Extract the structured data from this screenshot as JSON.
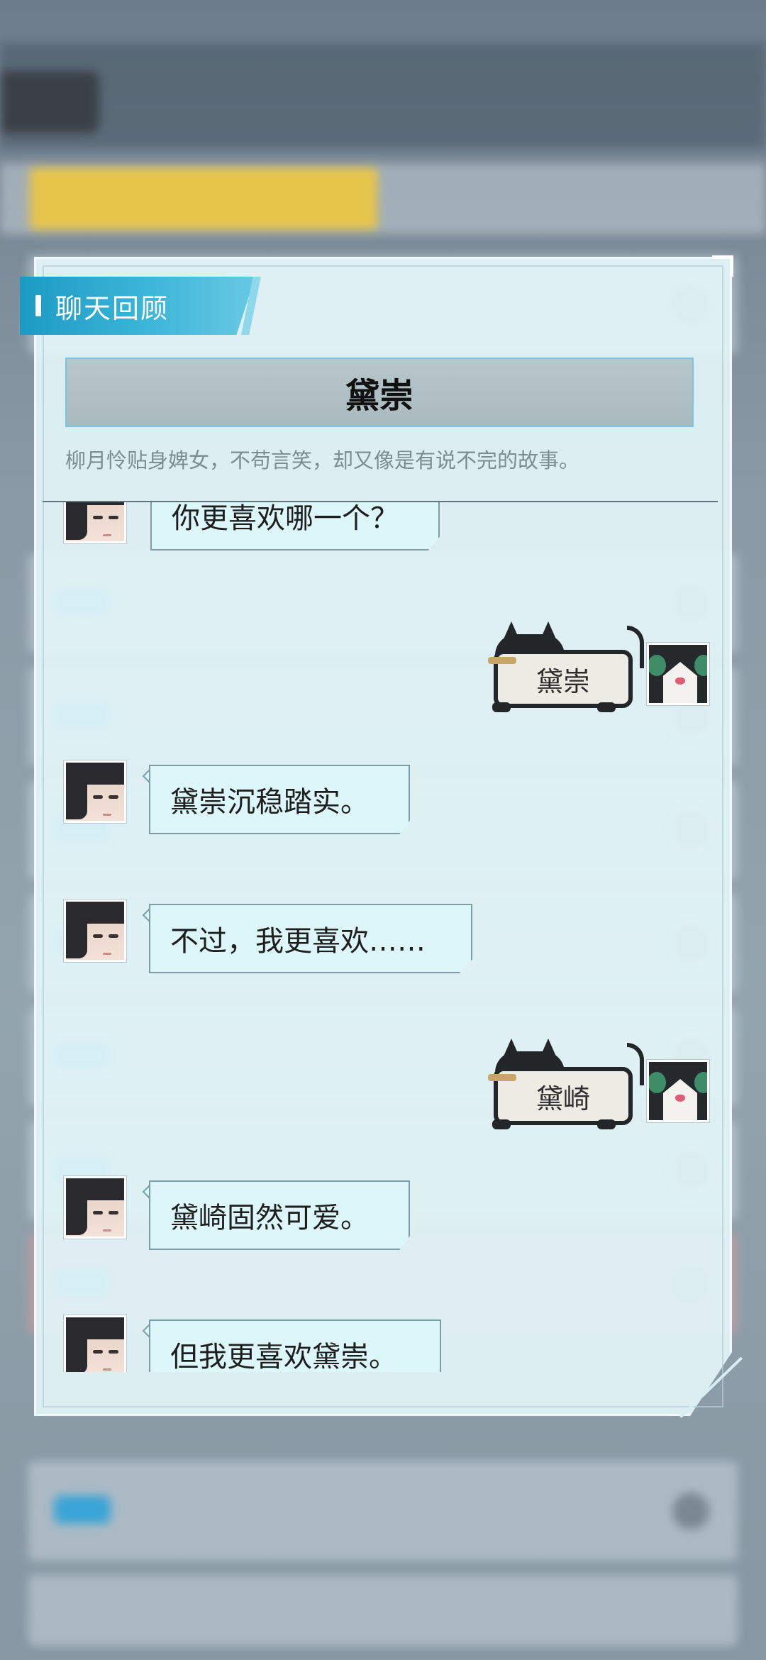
{
  "panel": {
    "header_label": "聊天回顾",
    "character_name": "黛崇",
    "character_description": "柳月怜贴身婢女，不苟言笑，却又像是有说不完的故事。"
  },
  "messages": [
    {
      "speaker": "npc",
      "text": "你更喜欢哪一个？"
    },
    {
      "speaker": "player",
      "text": "黛崇"
    },
    {
      "speaker": "npc",
      "text": "黛崇沉稳踏实。"
    },
    {
      "speaker": "npc",
      "text": "不过，我更喜欢……"
    },
    {
      "speaker": "player",
      "text": "黛崎"
    },
    {
      "speaker": "npc",
      "text": "黛崎固然可爱。"
    },
    {
      "speaker": "npc",
      "text": "但我更喜欢黛崇。"
    }
  ],
  "colors": {
    "header_tab": "#3cb6d9",
    "name_box_border": "#79c7dd",
    "npc_bubble": "#ddf6fa",
    "panel_bg": "#e2f4f8"
  },
  "icons": {
    "npc_avatar": "npc-portrait-icon",
    "player_avatar": "black-white-cat-avatar-icon",
    "player_bubble": "cat-shaped-bubble-icon"
  }
}
